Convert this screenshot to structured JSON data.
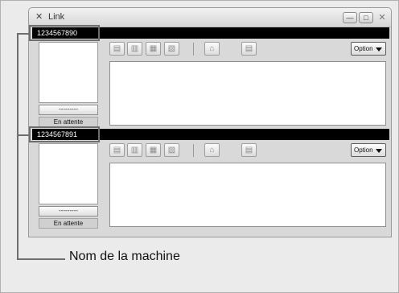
{
  "window": {
    "title": "Link",
    "icon": "link-icon",
    "min_label": "—",
    "max_label": "□",
    "close_label": "✕"
  },
  "panels": [
    {
      "machine_name": "1234567890",
      "dots_label": "---------",
      "status_label": "En attente",
      "option_label": "Option"
    },
    {
      "machine_name": "1234567891",
      "dots_label": "---------",
      "status_label": "En attente",
      "option_label": "Option"
    }
  ],
  "toolbar": {
    "icons": [
      "printer-icon",
      "scanner-icon",
      "transfer-icon",
      "settings-icon",
      "utility-icon",
      "document-icon"
    ]
  },
  "callout": {
    "label": "Nom de la machine"
  }
}
